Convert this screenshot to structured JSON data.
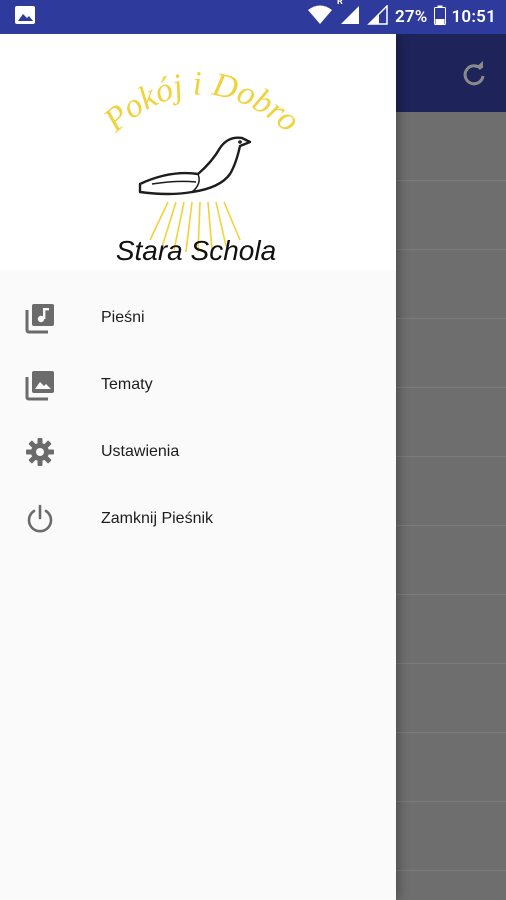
{
  "status_bar": {
    "battery_text": "27%",
    "time": "10:51",
    "roaming_indicator": "R",
    "icons": [
      "image-notification-icon",
      "wifi-icon",
      "signal-icon",
      "signal-icon",
      "battery-icon"
    ]
  },
  "drawer": {
    "header": {
      "logo_arc_text": "Pokój i Dobro",
      "logo_name": "Stara Schola"
    },
    "items": [
      {
        "label": "Pieśni",
        "icon": "music-library-icon"
      },
      {
        "label": "Tematy",
        "icon": "photo-library-icon"
      },
      {
        "label": "Ustawienia",
        "icon": "gear-icon"
      },
      {
        "label": "Zamknij Pieśnik",
        "icon": "power-icon"
      }
    ]
  },
  "colors": {
    "status_bar": "#2f3a9d",
    "toolbar": "#1e2459",
    "logo_yellow": "#f2d23c",
    "icon_gray": "#6b6b6b"
  }
}
